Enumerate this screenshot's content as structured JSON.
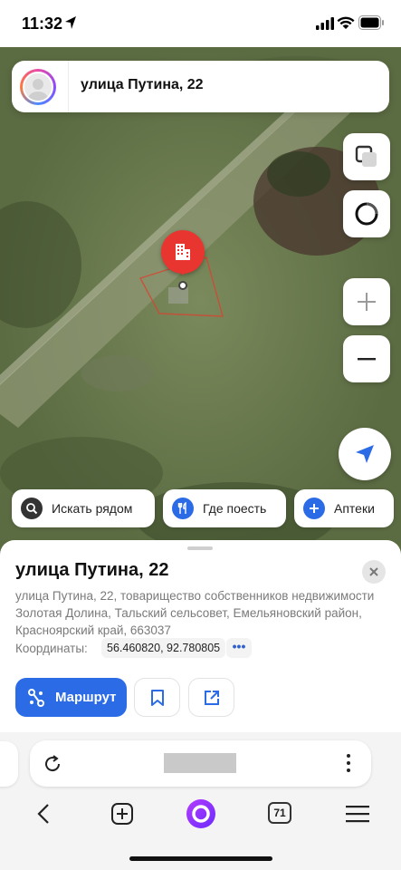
{
  "status_bar": {
    "time": "11:32"
  },
  "search": {
    "query": "улица Путина, 22"
  },
  "chips": [
    {
      "label": "Искать рядом",
      "icon": "search-icon",
      "color": "#333333"
    },
    {
      "label": "Где поесть",
      "icon": "fork-knife-icon",
      "color": "#2b6be6"
    },
    {
      "label": "Аптеки",
      "icon": "plus-icon",
      "color": "#2b6be6"
    }
  ],
  "place": {
    "title": "улица Путина, 22",
    "address": "улица Путина, 22, товарищество собственников недвижимости Золотая Долина, Тальский сельсовет, Емельяновский район, Красноярский край, 663037",
    "coords_label": "Координаты:",
    "coords_value": "56.460820, 92.780805",
    "coords_more": "•••"
  },
  "actions": {
    "route_label": "Маршрут"
  },
  "browser": {
    "url": "",
    "tabs_count": "71"
  },
  "colors": {
    "accent": "#2b6be6",
    "pin": "#e8352f"
  }
}
